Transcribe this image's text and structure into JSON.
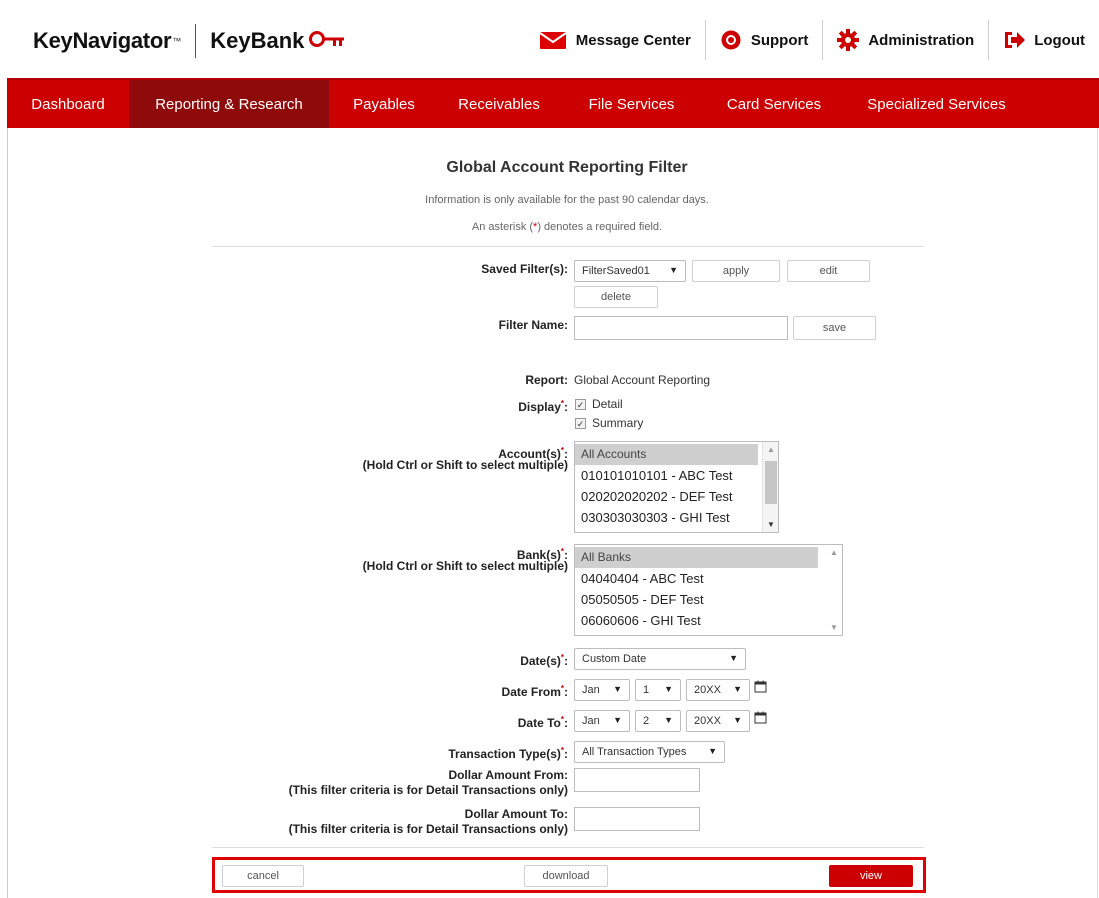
{
  "header": {
    "brand_primary": "KeyNavigator",
    "brand_tm": "™",
    "brand_secondary": "KeyBank",
    "util": {
      "message_center": "Message Center",
      "support": "Support",
      "administration": "Administration",
      "logout": "Logout"
    }
  },
  "nav": {
    "tabs": [
      {
        "label": "Dashboard"
      },
      {
        "label": "Reporting & Research"
      },
      {
        "label": "Payables"
      },
      {
        "label": "Receivables"
      },
      {
        "label": "File Services"
      },
      {
        "label": "Card Services"
      },
      {
        "label": "Specialized Services"
      }
    ],
    "active_index": 1
  },
  "page": {
    "title": "Global Account Reporting Filter",
    "note1": "Information is only available for the past 90 calendar days.",
    "note2_pre": "An asterisk (",
    "note2_star": "*",
    "note2_post": ") denotes a required field."
  },
  "form": {
    "saved_filters_label": "Saved Filter(s):",
    "saved_filter_value": "FilterSaved01",
    "apply": "apply",
    "edit": "edit",
    "delete": "delete",
    "filter_name_label": "Filter Name:",
    "filter_name_value": "",
    "save": "save",
    "report_label": "Report:",
    "report_value": "Global Account Reporting",
    "display_label": "Display",
    "display_options": [
      {
        "label": "Detail",
        "checked": true
      },
      {
        "label": "Summary",
        "checked": true
      }
    ],
    "accounts_label": "Account(s)",
    "accounts_hint": "(Hold Ctrl or Shift to select multiple)",
    "accounts": [
      "All Accounts",
      "010101010101 - ABC Test",
      "020202020202 - DEF Test",
      "030303030303 - GHI Test"
    ],
    "banks_label": "Bank(s)",
    "banks_hint": "(Hold Ctrl or Shift to select multiple)",
    "banks": [
      "All Banks",
      "04040404 - ABC Test",
      "05050505 - DEF Test",
      "06060606 - GHI Test"
    ],
    "dates_label": "Date(s)",
    "dates_value": "Custom Date",
    "date_from_label": "Date From",
    "date_from": {
      "month": "Jan",
      "day": "1",
      "year": "20XX"
    },
    "date_to_label": "Date To",
    "date_to": {
      "month": "Jan",
      "day": "2",
      "year": "20XX"
    },
    "txn_type_label": "Transaction Type(s)",
    "txn_type_value": "All Transaction Types",
    "dollar_from_label": "Dollar Amount From:",
    "dollar_from_hint": "(This filter criteria is for Detail Transactions only)",
    "dollar_to_label": "Dollar Amount To:",
    "dollar_to_hint": "(This filter criteria is for Detail Transactions only)",
    "required_mark": "*",
    "colon": ":"
  },
  "footer": {
    "cancel": "cancel",
    "download": "download",
    "view": "view"
  },
  "colors": {
    "brand_red": "#cc0000",
    "active_tab": "#8f0a0a",
    "highlight_box": "#e00000"
  }
}
